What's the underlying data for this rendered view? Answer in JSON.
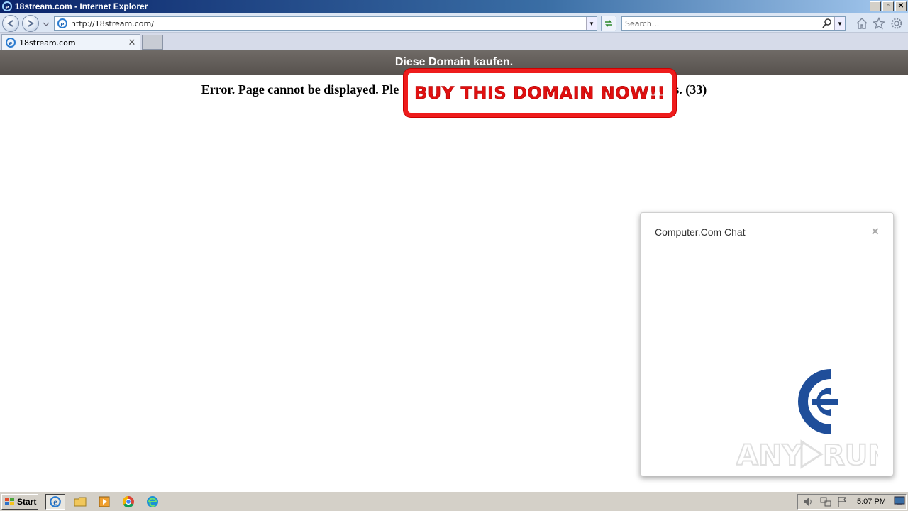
{
  "window": {
    "title": "18stream.com - Internet Explorer"
  },
  "toolbar": {
    "url": "http://18stream.com/",
    "search_placeholder": "Search..."
  },
  "tabs": [
    {
      "label": "18stream.com"
    }
  ],
  "page": {
    "banner": "Diese Domain kaufen.",
    "error_message": "Error. Page cannot be displayed. Ple",
    "error_tail": "ds. (33)",
    "buy_text": "BUY THIS DOMAIN NOW!!"
  },
  "chat": {
    "title": "Computer.Com Chat",
    "close": "×"
  },
  "taskbar": {
    "start_label": "Start",
    "clock": "5:07 PM"
  },
  "colors": {
    "accent_red": "#ee1c1c",
    "banner_gray": "#625d59",
    "logo_blue": "#1f4e9a"
  },
  "icons": [
    "ie-icon",
    "back-icon",
    "forward-icon",
    "refresh-icon",
    "search-icon",
    "home-icon",
    "favorites-icon",
    "gear-icon",
    "folder-icon",
    "media-icon",
    "chrome-icon",
    "edge-icon",
    "volume-icon",
    "network-icon",
    "flag-icon"
  ]
}
